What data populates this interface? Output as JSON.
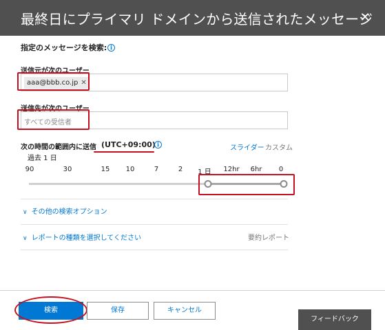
{
  "dialog": {
    "title": "最終日にプライマリ ドメインから送信されたメッセージ",
    "close_icon": "close-icon"
  },
  "search_section": {
    "heading": "指定のメッセージを検索:",
    "info_icon": "i"
  },
  "sender": {
    "label": "送信元が次のユーザー",
    "chip_value": "aaa@bbb.co.jp",
    "chip_remove": "✕"
  },
  "recipient": {
    "label": "送信先が次のユーザー",
    "placeholder": "すべての受信者"
  },
  "time_range": {
    "label": "次の時間の範囲内に送信",
    "timezone": "(UTC+09:00)",
    "info_icon": "i",
    "tab_slider": "スライダー",
    "tab_custom": "カスタム",
    "caption": "過去 1 日",
    "ticks": [
      "90",
      "30",
      "15",
      "10",
      "7",
      "2",
      "1 日",
      "12hr",
      "6hr",
      "0"
    ],
    "selected_from": "1 日",
    "selected_to": "0"
  },
  "options": {
    "more_search_options": "その他の検索オプション",
    "report_type": "レポートの種類を選択してください",
    "report_type_value": "要約レポート",
    "chevron": "∨"
  },
  "buttons": {
    "search": "検索",
    "save": "保存",
    "cancel": "キャンセル",
    "feedback": "フィードバック"
  },
  "colors": {
    "accent": "#0078d4",
    "header": "#505050",
    "highlight": "#c50f1f"
  }
}
